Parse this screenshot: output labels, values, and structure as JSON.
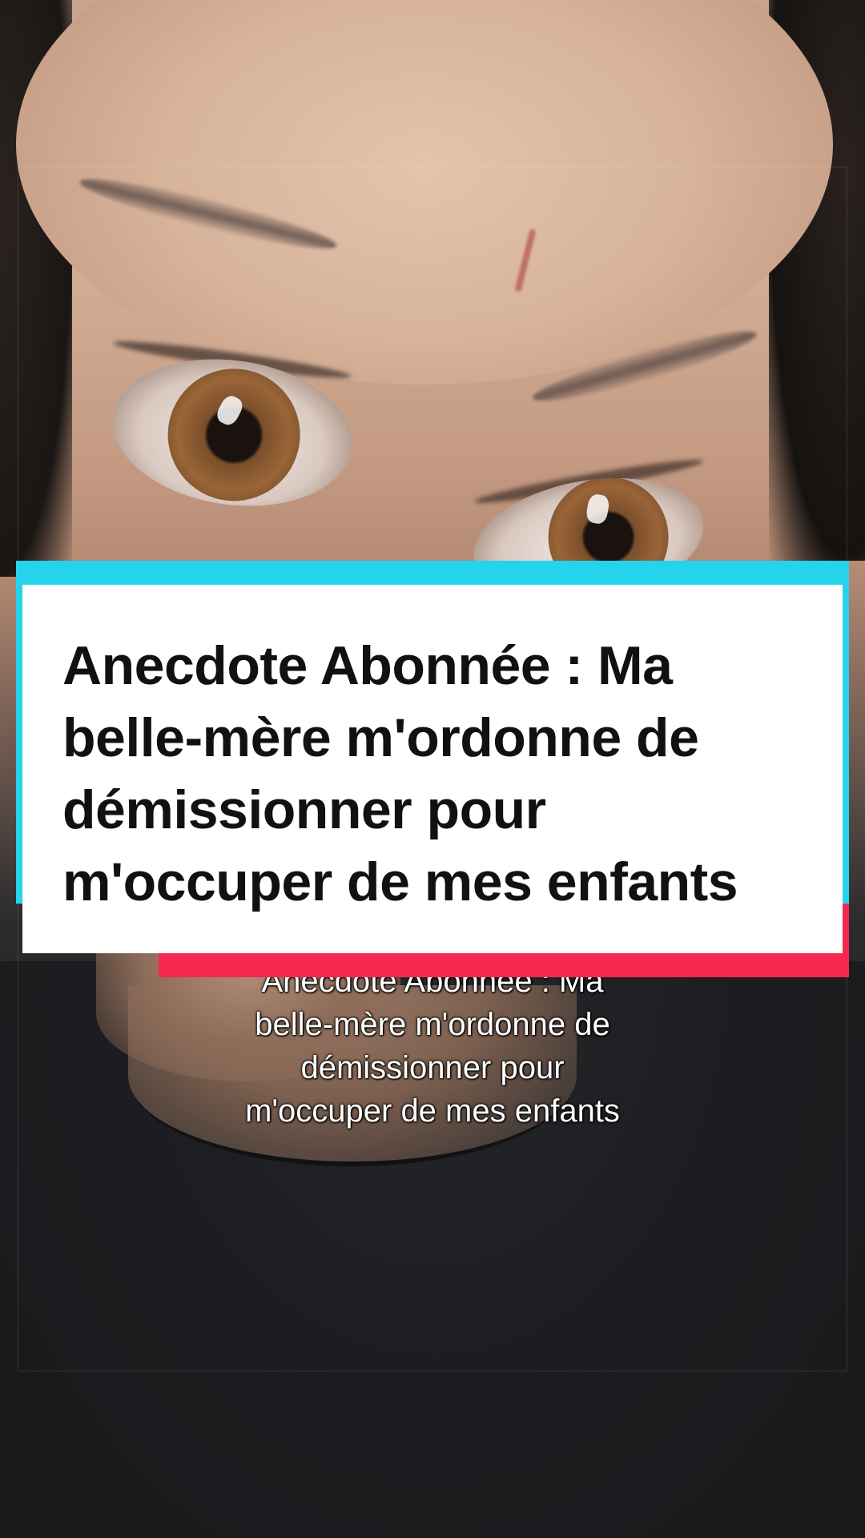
{
  "card": {
    "title_lines": [
      "Anecdote Abonnée : Ma",
      "belle-mère m'ordonne de",
      "démissionner pour",
      "m'occuper de mes enfants"
    ]
  },
  "subtitle": {
    "lines": [
      "Anecdote Abonnée : Ma",
      "belle-mère m'ordonne de",
      "démissionner pour",
      "m'occuper de mes enfants"
    ]
  },
  "colors": {
    "accent_cyan": "#25d4ec",
    "accent_pink": "#f5284f",
    "card_bg": "#ffffff",
    "title_text": "#111111"
  }
}
